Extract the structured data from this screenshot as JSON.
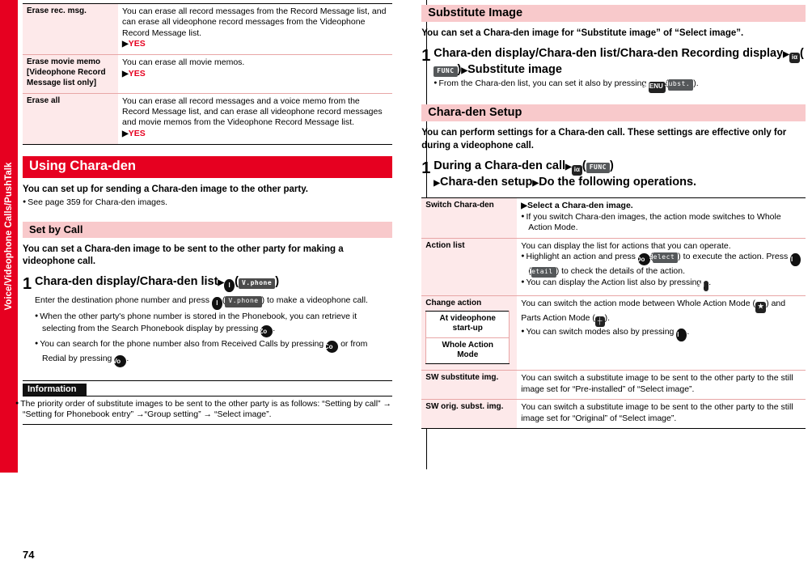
{
  "side_tab": {
    "label": "Voice/Videophone Calls/PushTalk"
  },
  "page_number": "74",
  "left": {
    "erase_table": {
      "rows": [
        {
          "key": "Erase rec. msg.",
          "value": "You can erase all record messages from the Record Message list, and can erase all videophone record messages from the Videophone Record Message list.",
          "confirm": "YES"
        },
        {
          "key": "Erase movie memo [Videophone Record Message list only]",
          "value": "You can erase all movie memos.",
          "confirm": "YES"
        },
        {
          "key": "Erase all",
          "value": "You can erase all record messages and a voice memo from the Record Message list, and can erase all videophone record messages and movie memos from the Videophone Record Message list.",
          "confirm": "YES"
        }
      ]
    },
    "section_title": "Using Chara-den",
    "section_lead": "You can set up for sending a Chara-den image to the other party.",
    "section_note": "See page 359 for Chara-den images.",
    "sub_title": "Set by Call",
    "sub_lead": "You can set a Chara-den image to be sent to the other party for making a videophone call.",
    "step": {
      "num": "1",
      "title_a": "Chara-den display/Chara-den list",
      "title_key": "l",
      "title_lcd": "V.phone",
      "desc_a": "Enter the destination phone number and press",
      "desc_key": "l",
      "desc_lcd": "V.phone",
      "desc_b": "to make a videophone call.",
      "bullets": [
        "When the other party's phone number is stored in the Phonebook, you can retrieve it selecting from the Search Phonebook display by pressing",
        "You can search for the phone number also from Received Calls by pressing",
        "or from Redial by pressing"
      ],
      "bullet_keys": [
        "Zo",
        "Co",
        "Vo"
      ]
    },
    "information": {
      "header": "Information",
      "text": "The priority order of substitute images to be sent to the other party is as follows: “Setting by call” → “Setting for Phonebook entry” →“Group setting” → “Select image”."
    }
  },
  "right": {
    "substitute": {
      "title": "Substitute Image",
      "lead": "You can set a Chara-den image for “Substitute image” of “Select image”.",
      "step": {
        "num": "1",
        "title_a": "Chara-den display/Chara-den list/Chara-den Recording display",
        "title_key": "iα",
        "title_lcd": "FUNC",
        "title_b": "Substitute image",
        "bullet": "From the Chara-den list, you can set it also by pressing",
        "bullet_key": "MENU",
        "bullet_lcd": "Subst.",
        "bullet_end": "."
      }
    },
    "setup": {
      "title": "Chara-den Setup",
      "lead": "You can perform settings for a Chara-den call. These settings are effective only for during a videophone call.",
      "step": {
        "num": "1",
        "title_a": "During a Chara-den call",
        "title_key": "iα",
        "title_lcd": "FUNC",
        "title_b": "Chara-den setup",
        "title_c": "Do the following operations."
      },
      "table": {
        "rows": [
          {
            "key": "Switch Chara-den",
            "lines": [
              {
                "type": "arrow",
                "text": "Select a Chara-den image."
              },
              {
                "type": "bullet",
                "text": "If you switch Chara-den images, the action mode switches to Whole Action Mode."
              }
            ]
          },
          {
            "key": "Action list",
            "lines": [
              {
                "type": "plain",
                "text": "You can display the list for actions that you can operate."
              },
              {
                "type": "bullet",
                "text": "Highlight an action and press Oo (Select) to execute the action. Press l (Detail) to check the details of the action."
              },
              {
                "type": "bullet",
                "text": "You can display the Action list also by pressing a."
              }
            ]
          },
          {
            "key": "Change action",
            "lines": [
              {
                "type": "plain",
                "text": "You can switch the action mode between Whole Action Mode ( ) and Parts Action Mode ( )."
              },
              {
                "type": "bullet",
                "text": "You can switch modes also by pressing l."
              }
            ],
            "mini_table": [
              "At videophone start-up",
              "Whole Action Mode"
            ]
          },
          {
            "key": "SW substitute img.",
            "lines": [
              {
                "type": "plain",
                "text": "You can switch a substitute image to be sent to the other party to the still image set for “Pre-installed” of “Select image”."
              }
            ]
          },
          {
            "key": "SW orig. subst. img.",
            "lines": [
              {
                "type": "plain",
                "text": "You can switch a substitute image to be sent to the other party to the still image set for “Original” of “Select image”."
              }
            ]
          }
        ]
      }
    }
  }
}
